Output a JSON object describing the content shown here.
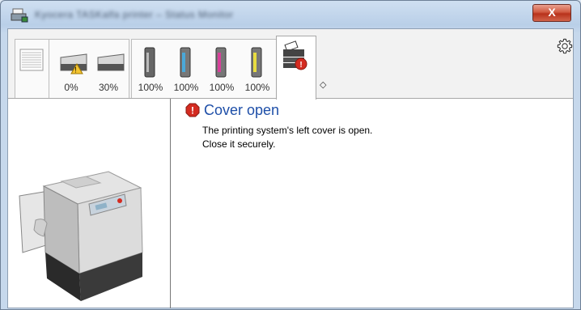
{
  "window": {
    "title": "Kyocera TASKalfa printer – Status Monitor",
    "close_glyph": "X"
  },
  "toolbar": {
    "tabs": [
      {
        "name": "paper-stack",
        "label": ""
      },
      {
        "name": "paper-tray-1",
        "label": "0%",
        "warning": true
      },
      {
        "name": "paper-tray-2",
        "label": "30%"
      },
      {
        "name": "toner-black",
        "label": "100%",
        "color": "#555555"
      },
      {
        "name": "toner-cyan",
        "label": "100%",
        "color": "#4aa8d8"
      },
      {
        "name": "toner-magenta",
        "label": "100%",
        "color": "#d8409a"
      },
      {
        "name": "toner-yellow",
        "label": "100%",
        "color": "#e8dc40"
      }
    ],
    "active_tab": "printer-error",
    "collapse_glyph": "◇",
    "settings_icon": "gear-icon"
  },
  "message": {
    "title": "Cover open",
    "lines": [
      "The printing system's left cover is open.",
      "Close it securely."
    ]
  },
  "colors": {
    "error": "#d42b20",
    "title_blue": "#1e4fa8"
  }
}
